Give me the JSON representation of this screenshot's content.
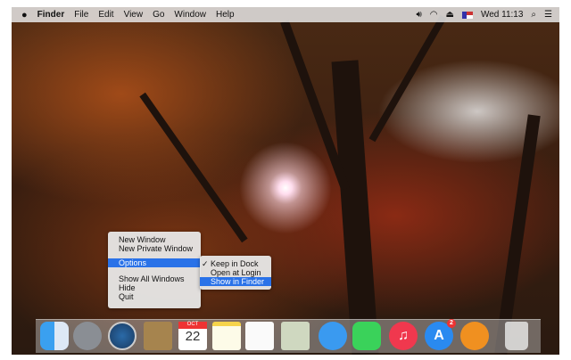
{
  "menubar": {
    "apple": "",
    "app": "Finder",
    "items": [
      "File",
      "Edit",
      "View",
      "Go",
      "Window",
      "Help"
    ],
    "clock": "Wed 11:13"
  },
  "context_menu": {
    "items": [
      "New Window",
      "New Private Window",
      "Options",
      "Show All Windows",
      "Hide",
      "Quit"
    ]
  },
  "submenu": {
    "check": "✓",
    "items": [
      "Keep in Dock",
      "Open at Login",
      "Show in Finder"
    ]
  },
  "dock": {
    "calendar_month": "OCT",
    "calendar_day": "22",
    "appstore_badge": "2",
    "apps": [
      "Finder",
      "Launchpad",
      "Safari",
      "Contacts",
      "Calendar",
      "Notes",
      "Reminders",
      "Preview",
      "Messages",
      "FaceTime",
      "iTunes",
      "App Store",
      "iBooks",
      "Trash"
    ]
  }
}
